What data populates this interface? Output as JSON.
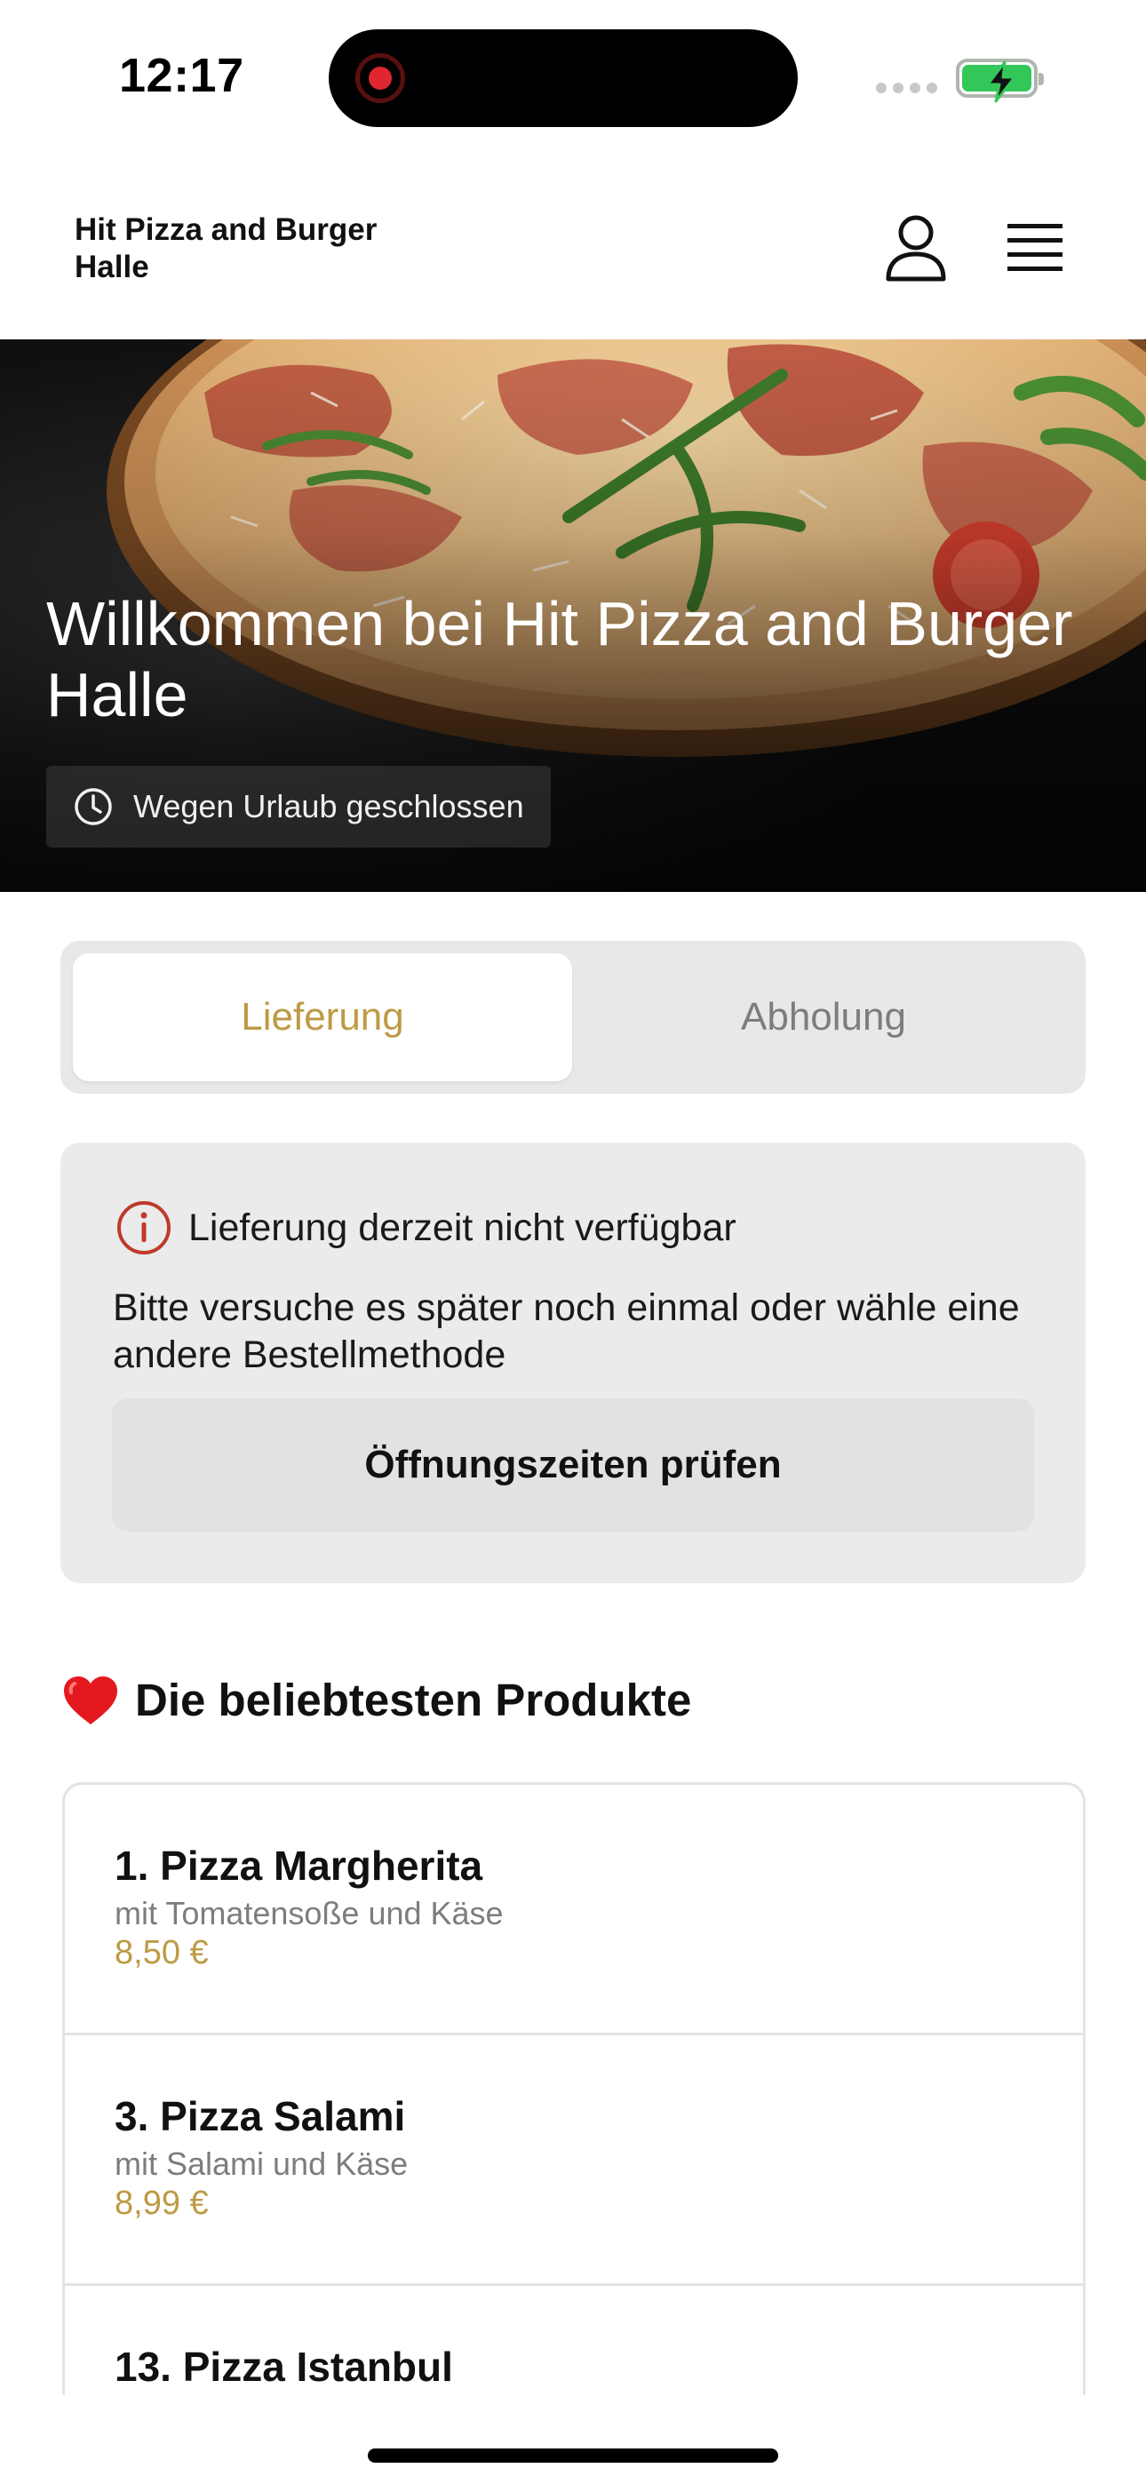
{
  "status_bar": {
    "time": "12:17"
  },
  "header": {
    "brand": "Hit Pizza and Burger Halle",
    "icons": {
      "account": "user-icon",
      "menu": "hamburger-menu-icon"
    }
  },
  "hero": {
    "title": "Willkommen bei Hit Pizza and Burger Halle",
    "status": "Wegen Urlaub geschlossen",
    "status_icon": "clock-icon"
  },
  "order_method": {
    "options": [
      {
        "label": "Lieferung",
        "selected": true
      },
      {
        "label": "Abholung",
        "selected": false
      }
    ]
  },
  "notice": {
    "title": "Lieferung derzeit nicht verfügbar",
    "text": "Bitte versuche es später noch einmal oder wähle eine andere Bestellmethode",
    "button": "Öffnungszeiten prüfen",
    "icon": "info-icon"
  },
  "popular": {
    "emoji": "❤️",
    "title": "Die beliebtesten Produkte",
    "items": [
      {
        "name": "1. Pizza Margherita",
        "description": "mit Tomatensoße und Käse",
        "price": "8,50 €"
      },
      {
        "name": "3. Pizza Salami",
        "description": "mit Salami und Käse",
        "price": "8,99 €"
      },
      {
        "name": "13. Pizza Istanbul",
        "description": "",
        "price": ""
      }
    ]
  },
  "colors": {
    "accent": "#bd9b45",
    "notice_icon": "#c0392b",
    "battery": "#33c759",
    "recording": "#e0262f"
  }
}
